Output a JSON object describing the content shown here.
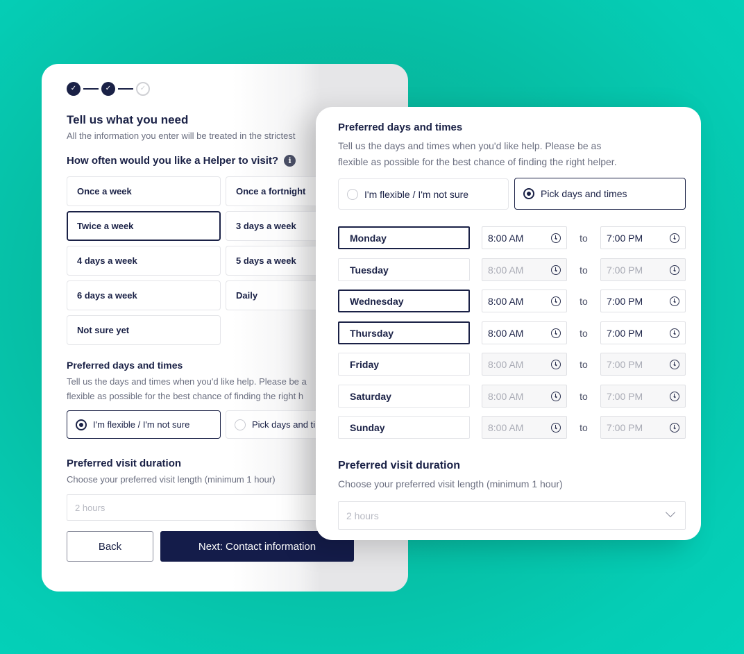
{
  "colors": {
    "background": "#03c9b0",
    "primary_navy": "#141c4a",
    "text_dark": "#1a2146",
    "text_muted": "#6b6f80"
  },
  "back_card": {
    "stepper": {
      "steps": [
        {
          "state": "complete",
          "icon": "check-icon"
        },
        {
          "state": "complete",
          "icon": "check-icon"
        },
        {
          "state": "incomplete",
          "icon": "check-icon"
        }
      ]
    },
    "title": "Tell us what you need",
    "subtitle": "All the information you enter will be treated in the strictest",
    "frequency": {
      "question": "How often would you like a Helper to visit?",
      "info_icon": "i",
      "options": [
        {
          "label": "Once a week",
          "selected": false
        },
        {
          "label": "Once a fortnight",
          "selected": false
        },
        {
          "label": "Twice a week",
          "selected": true
        },
        {
          "label": "3 days a week",
          "selected": false
        },
        {
          "label": "4 days a week",
          "selected": false
        },
        {
          "label": "5 days a week",
          "selected": false
        },
        {
          "label": "6 days a week",
          "selected": false
        },
        {
          "label": "Daily",
          "selected": false
        },
        {
          "label": "Not sure yet",
          "selected": false
        }
      ]
    },
    "days_times": {
      "title": "Preferred days and times",
      "desc_line1": "Tell us the days and times when you'd like help. Please be a",
      "desc_line2": "flexible as possible for the best chance of finding the right h",
      "options": [
        {
          "label": "I'm flexible / I'm not sure",
          "selected": true
        },
        {
          "label": "Pick days and ti",
          "selected": false
        }
      ]
    },
    "duration": {
      "title": "Preferred visit duration",
      "desc": "Choose your preferred visit length (minimum 1 hour)",
      "value": "2 hours"
    },
    "buttons": {
      "back": "Back",
      "next": "Next: Contact information"
    }
  },
  "front_card": {
    "days_times": {
      "title": "Preferred days and times",
      "desc_line1": "Tell us the days and times when you'd like help. Please be as",
      "desc_line2": "flexible as possible for the best chance of finding the right helper.",
      "options": [
        {
          "label": "I'm flexible / I'm not sure",
          "selected": false
        },
        {
          "label": "Pick days and times",
          "selected": true
        }
      ]
    },
    "to_label": "to",
    "schedule": [
      {
        "day": "Monday",
        "active": true,
        "start": "8:00 AM",
        "end": "7:00 PM"
      },
      {
        "day": "Tuesday",
        "active": false,
        "start": "8:00 AM",
        "end": "7:00 PM"
      },
      {
        "day": "Wednesday",
        "active": true,
        "start": "8:00 AM",
        "end": "7:00 PM"
      },
      {
        "day": "Thursday",
        "active": true,
        "start": "8:00 AM",
        "end": "7:00 PM"
      },
      {
        "day": "Friday",
        "active": false,
        "start": "8:00 AM",
        "end": "7:00 PM"
      },
      {
        "day": "Saturday",
        "active": false,
        "start": "8:00 AM",
        "end": "7:00 PM"
      },
      {
        "day": "Sunday",
        "active": false,
        "start": "8:00 AM",
        "end": "7:00 PM"
      }
    ],
    "duration": {
      "title": "Preferred visit duration",
      "desc": "Choose your preferred visit length (minimum 1 hour)",
      "placeholder": "2 hours"
    }
  }
}
